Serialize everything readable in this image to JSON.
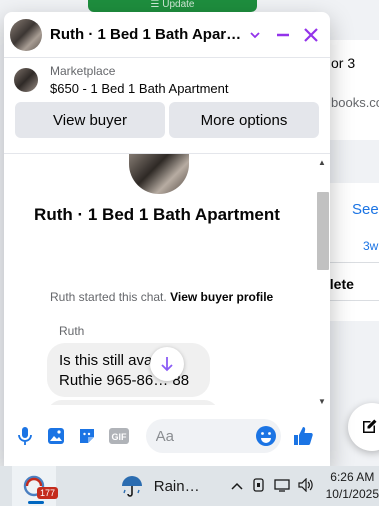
{
  "background": {
    "top_banner": "☰ Update",
    "partial_text_1": "or 3",
    "partial_link_1": "books.co",
    "see_link": "See",
    "partial_gray": "3w",
    "delete_text": "elete"
  },
  "chat": {
    "title": "Ruth · 1 Bed 1 Bath Apartm…",
    "marketplace_label": "Marketplace",
    "listing_title": "$650 - 1 Bed 1 Bath Apartment",
    "buttons": {
      "view_buyer": "View buyer",
      "more_options": "More options"
    },
    "conversation_title": "Ruth · 1 Bed 1 Bath Apartment",
    "started_text": "Ruth started this chat.",
    "view_profile": "View buyer profile",
    "sender_name": "Ruth",
    "message_line1": "Is this still ava… ?",
    "message_line2": "Ruthie 965-86… 88",
    "input_placeholder": "Aa"
  },
  "taskbar": {
    "app_badge": "177",
    "weather_label": "Rain…",
    "time": "6:26 AM",
    "date": "10/1/2025"
  },
  "colors": {
    "accent_purple": "#9333ea",
    "messenger_blue": "#1b74e4",
    "bubble_gray": "#f0f0f0"
  }
}
